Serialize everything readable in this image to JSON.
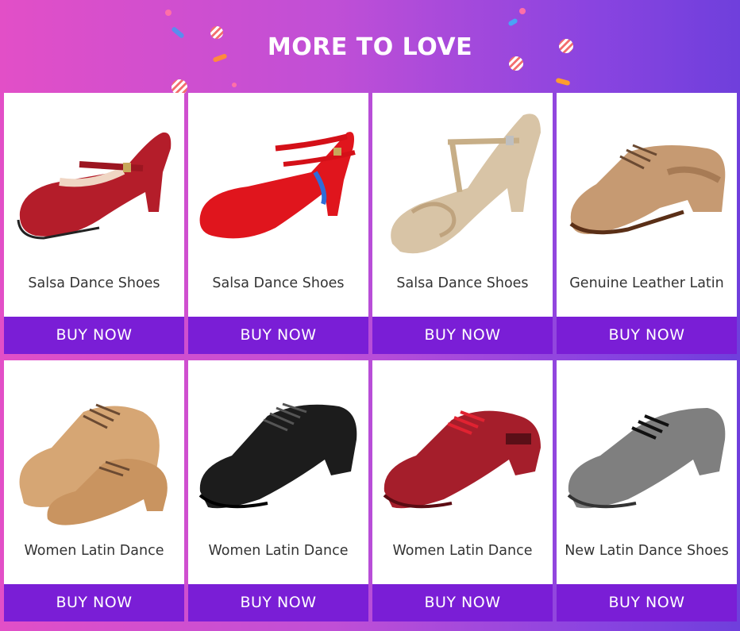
{
  "header": {
    "title": "MORE TO LOVE"
  },
  "colors": {
    "accent": "#7a1ed6",
    "gradient_start": "#e24fc7",
    "gradient_end": "#6f3fdc"
  },
  "products": [
    {
      "name": "Salsa  Dance Shoes",
      "button": "BUY  NOW",
      "image": "red-leather-mary-jane-heel",
      "color": "#b41d2a"
    },
    {
      "name": "Salsa  Dance Shoes",
      "button": "BUY  NOW",
      "image": "red-ankle-strap-heel",
      "color": "#e0151d"
    },
    {
      "name": "Salsa  Dance Shoes",
      "button": "BUY  NOW",
      "image": "gold-t-strap-heel",
      "color": "#d8c4a6"
    },
    {
      "name": "Genuine Leather Latin",
      "button": "BUY  NOW",
      "image": "tan-mesh-practice-shoe",
      "color": "#c69a72"
    },
    {
      "name": "Women Latin Dance",
      "button": "BUY  NOW",
      "image": "beige-lace-up-shoes",
      "color": "#d6a674"
    },
    {
      "name": "Women Latin Dance",
      "button": "BUY  NOW",
      "image": "black-lace-up-shoe",
      "color": "#1c1c1c"
    },
    {
      "name": "Women Latin Dance",
      "button": "BUY  NOW",
      "image": "red-lace-up-shoe",
      "color": "#a51e2b"
    },
    {
      "name": "New Latin Dance Shoes",
      "button": "BUY  NOW",
      "image": "grey-lace-up-shoe",
      "color": "#7f7f7f"
    }
  ]
}
